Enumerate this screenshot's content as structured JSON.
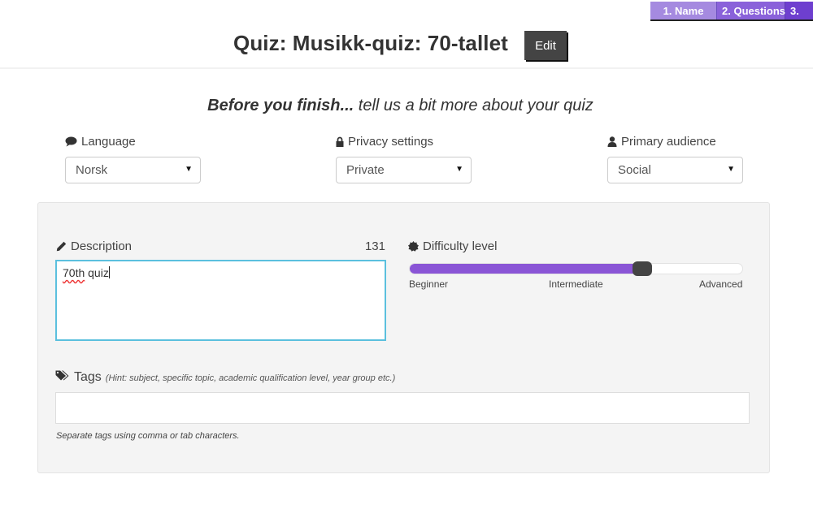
{
  "steps": [
    {
      "label": "1. Name"
    },
    {
      "label": "2. Questions"
    },
    {
      "label": "3."
    }
  ],
  "header": {
    "title": "Quiz: Musikk-quiz: 70-tallet",
    "edit_label": "Edit"
  },
  "subtitle": {
    "bold": "Before you finish...",
    "rest": " tell us a bit more about your quiz"
  },
  "settings": {
    "language": {
      "icon": "comment-icon",
      "label": "Language",
      "value": "Norsk"
    },
    "privacy": {
      "icon": "lock-icon",
      "label": "Privacy settings",
      "value": "Private"
    },
    "audience": {
      "icon": "user-icon",
      "label": "Primary audience",
      "value": "Social"
    }
  },
  "description": {
    "icon": "pencil-icon",
    "label": "Description",
    "remaining_chars": "131",
    "value_misspelled": "70th",
    "value_rest": " quiz"
  },
  "difficulty": {
    "icon": "certificate-icon",
    "label": "Difficulty level",
    "value_fraction": 0.7,
    "colors": {
      "fill": "#8a55d6",
      "handle": "#444444"
    },
    "labels": {
      "min": "Beginner",
      "mid": "Intermediate",
      "max": "Advanced"
    }
  },
  "tags": {
    "icon": "tags-icon",
    "label": "Tags",
    "hint": "(Hint: subject, specific topic, academic qualification level, year group etc.)",
    "value": "",
    "help": "Separate tags using comma or tab characters."
  }
}
